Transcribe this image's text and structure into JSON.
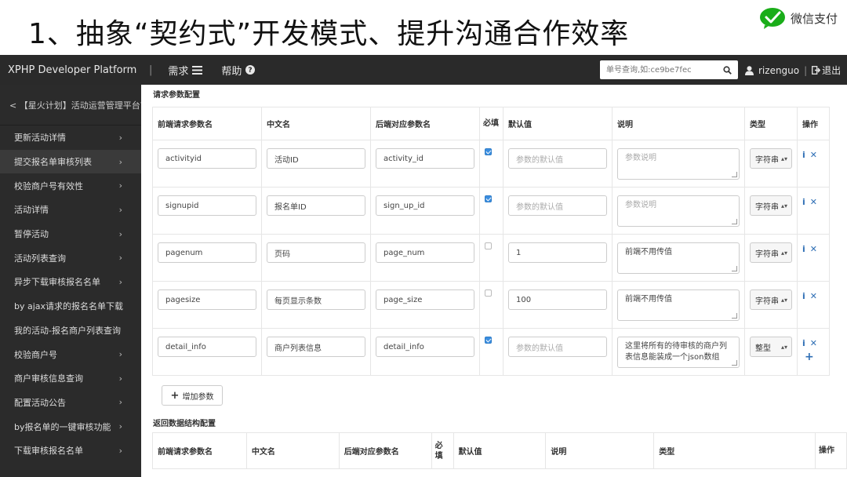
{
  "slide": {
    "title": "1、抽象“契约式”开发模式、提升沟通合作效率",
    "logo_text": "微信支付"
  },
  "navbar": {
    "brand": "XPHP Developer Platform",
    "separator": "|",
    "menu_requirements": "需求",
    "menu_help": "帮助",
    "search_placeholder": "单号查询,如:ce9be7fec",
    "username": "rizenguo",
    "logout": "退出"
  },
  "sidebar": {
    "header": "< 【星火计划】活动运营管理平台前",
    "items": [
      {
        "label": "更新活动详情"
      },
      {
        "label": "提交报名单审核列表"
      },
      {
        "label": "校验商户号有效性"
      },
      {
        "label": "活动详情"
      },
      {
        "label": "暂停活动"
      },
      {
        "label": "活动列表查询"
      },
      {
        "label": "异步下载审核报名名单"
      },
      {
        "label": "by ajax请求的报名名单下载"
      },
      {
        "label": "我的活动-报名商户列表查询"
      },
      {
        "label": "校验商户号"
      },
      {
        "label": "商户审核信息查询"
      },
      {
        "label": "配置活动公告"
      },
      {
        "label": "by报名单的一键审核功能"
      },
      {
        "label": "下载审核报名名单"
      }
    ]
  },
  "request": {
    "section_title": "请求参数配置",
    "headers": [
      "前端请求参数名",
      "中文名",
      "后端对应参数名",
      "必填",
      "默认值",
      "说明",
      "类型",
      "操作"
    ],
    "rows": [
      {
        "name": "activityid",
        "cn": "活动ID",
        "backend": "activity_id",
        "required": true,
        "default": "参数的默认值",
        "default_ph": true,
        "desc": "参数说明",
        "desc_ph": true,
        "type": "字符串"
      },
      {
        "name": "signupid",
        "cn": "报名单ID",
        "backend": "sign_up_id",
        "required": true,
        "default": "参数的默认值",
        "default_ph": true,
        "desc": "参数说明",
        "desc_ph": true,
        "type": "字符串"
      },
      {
        "name": "pagenum",
        "cn": "页码",
        "backend": "page_num",
        "required": false,
        "default": "1",
        "default_ph": false,
        "desc": "前端不用传值",
        "desc_ph": false,
        "type": "字符串"
      },
      {
        "name": "pagesize",
        "cn": "每页显示条数",
        "backend": "page_size",
        "required": false,
        "default": "100",
        "default_ph": false,
        "desc": "前端不用传值",
        "desc_ph": false,
        "type": "字符串"
      },
      {
        "name": "detail_info",
        "cn": "商户列表信息",
        "backend": "detail_info",
        "required": true,
        "default": "参数的默认值",
        "default_ph": true,
        "desc": "这里将所有的待审核的商户列表信息能装成一个json数组",
        "desc_ph": false,
        "type": "整型"
      }
    ],
    "add_button": "增加参数"
  },
  "response": {
    "section_title": "返回数据结构配置",
    "headers": [
      "前端请求参数名",
      "中文名",
      "后端对应参数名",
      "必填",
      "默认值",
      "说明",
      "类型",
      "操作"
    ]
  }
}
